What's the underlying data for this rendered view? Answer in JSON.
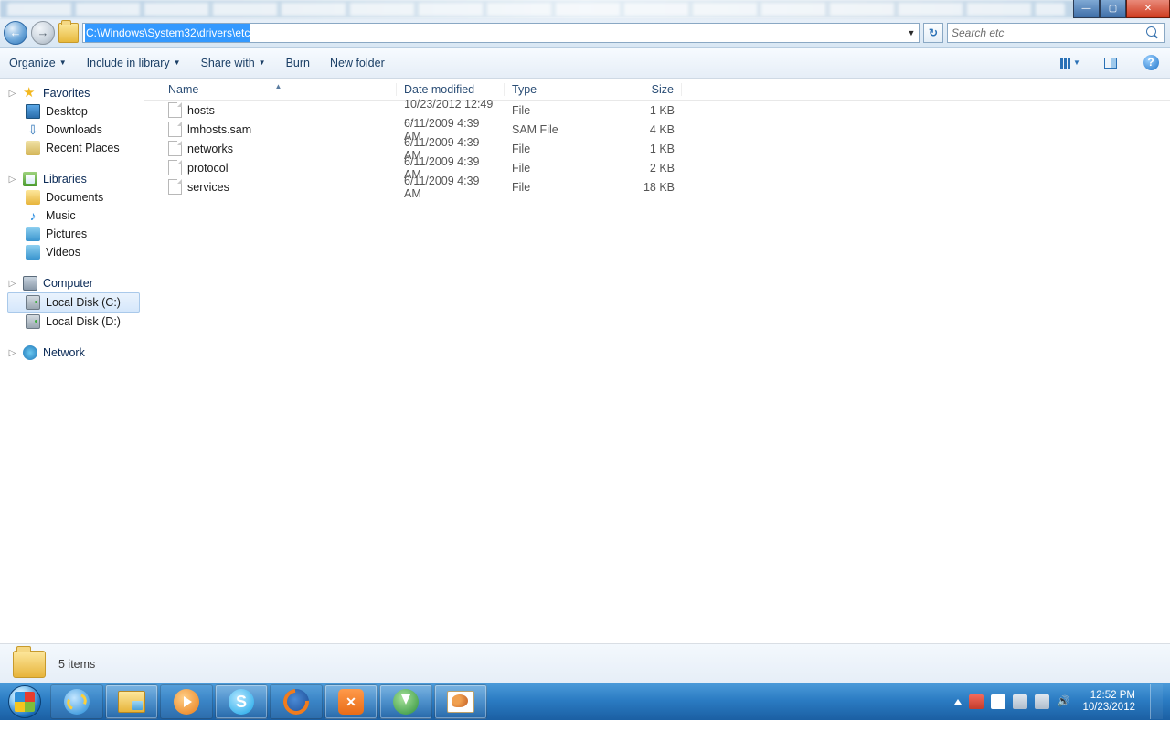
{
  "address_path": "C:\\Windows\\System32\\drivers\\etc",
  "search_placeholder": "Search etc",
  "toolbar": {
    "organize": "Organize",
    "include": "Include in library",
    "share": "Share with",
    "burn": "Burn",
    "newfolder": "New folder"
  },
  "sidebar": {
    "favorites": "Favorites",
    "desktop": "Desktop",
    "downloads": "Downloads",
    "recent": "Recent Places",
    "libraries": "Libraries",
    "documents": "Documents",
    "music": "Music",
    "pictures": "Pictures",
    "videos": "Videos",
    "computer": "Computer",
    "drive_c": "Local Disk (C:)",
    "drive_d": "Local Disk (D:)",
    "network": "Network"
  },
  "columns": {
    "name": "Name",
    "date": "Date modified",
    "type": "Type",
    "size": "Size"
  },
  "files": [
    {
      "name": "hosts",
      "date": "10/23/2012 12:49 ...",
      "type": "File",
      "size": "1 KB"
    },
    {
      "name": "lmhosts.sam",
      "date": "6/11/2009 4:39 AM",
      "type": "SAM File",
      "size": "4 KB"
    },
    {
      "name": "networks",
      "date": "6/11/2009 4:39 AM",
      "type": "File",
      "size": "1 KB"
    },
    {
      "name": "protocol",
      "date": "6/11/2009 4:39 AM",
      "type": "File",
      "size": "2 KB"
    },
    {
      "name": "services",
      "date": "6/11/2009 4:39 AM",
      "type": "File",
      "size": "18 KB"
    }
  ],
  "status_text": "5 items",
  "tray": {
    "time": "12:52 PM",
    "date": "10/23/2012"
  }
}
